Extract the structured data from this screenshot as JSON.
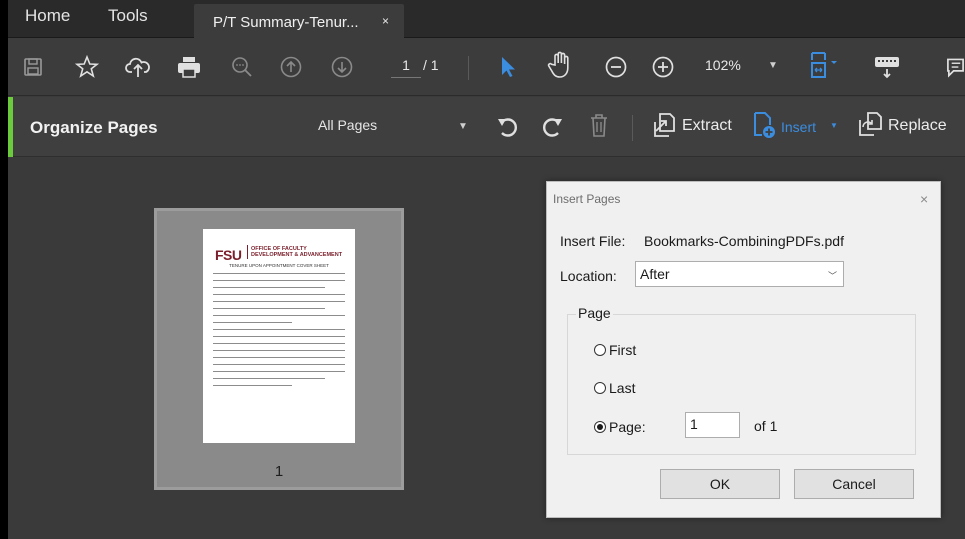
{
  "menubar": {
    "home": "Home",
    "tools": "Tools",
    "tab_title": "P/T Summary-Tenur...",
    "tab_close": "×"
  },
  "toolbar": {
    "page_current": "1",
    "page_total": "/ 1",
    "zoom": "102%",
    "icons": [
      "save-icon",
      "bookmark-star-icon",
      "upload-cloud-icon",
      "print-icon",
      "zoom-marquee-icon",
      "page-up-icon",
      "page-down-icon",
      "select-arrow-icon",
      "hand-icon",
      "zoom-out-icon",
      "zoom-in-icon",
      "fit-page-icon",
      "keyboard-icon",
      "comment-icon"
    ],
    "accent": "#3b8de0"
  },
  "organize": {
    "title": "Organize Pages",
    "filter": "All Pages",
    "extract": "Extract",
    "insert": "Insert",
    "replace": "Replace",
    "accent": "#6ccb3c"
  },
  "thumbnail": {
    "page_number": "1",
    "logo": "FSU",
    "logo_sub_1": "OFFICE OF FACULTY",
    "logo_sub_2": "DEVELOPMENT & ADVANCEMENT",
    "sheet_title": "TENURE UPON APPOINTMENT COVER SHEET"
  },
  "dialog": {
    "title": "Insert Pages",
    "close": "×",
    "file_label": "Insert File:",
    "file_value": "Bookmarks-CombiningPDFs.pdf",
    "location_label": "Location:",
    "location_value": "After",
    "group_label": "Page",
    "first_label": "First",
    "last_label": "Last",
    "page_label": "Page:",
    "page_value": "1",
    "of_label": "of 1",
    "ok": "OK",
    "cancel": "Cancel"
  }
}
